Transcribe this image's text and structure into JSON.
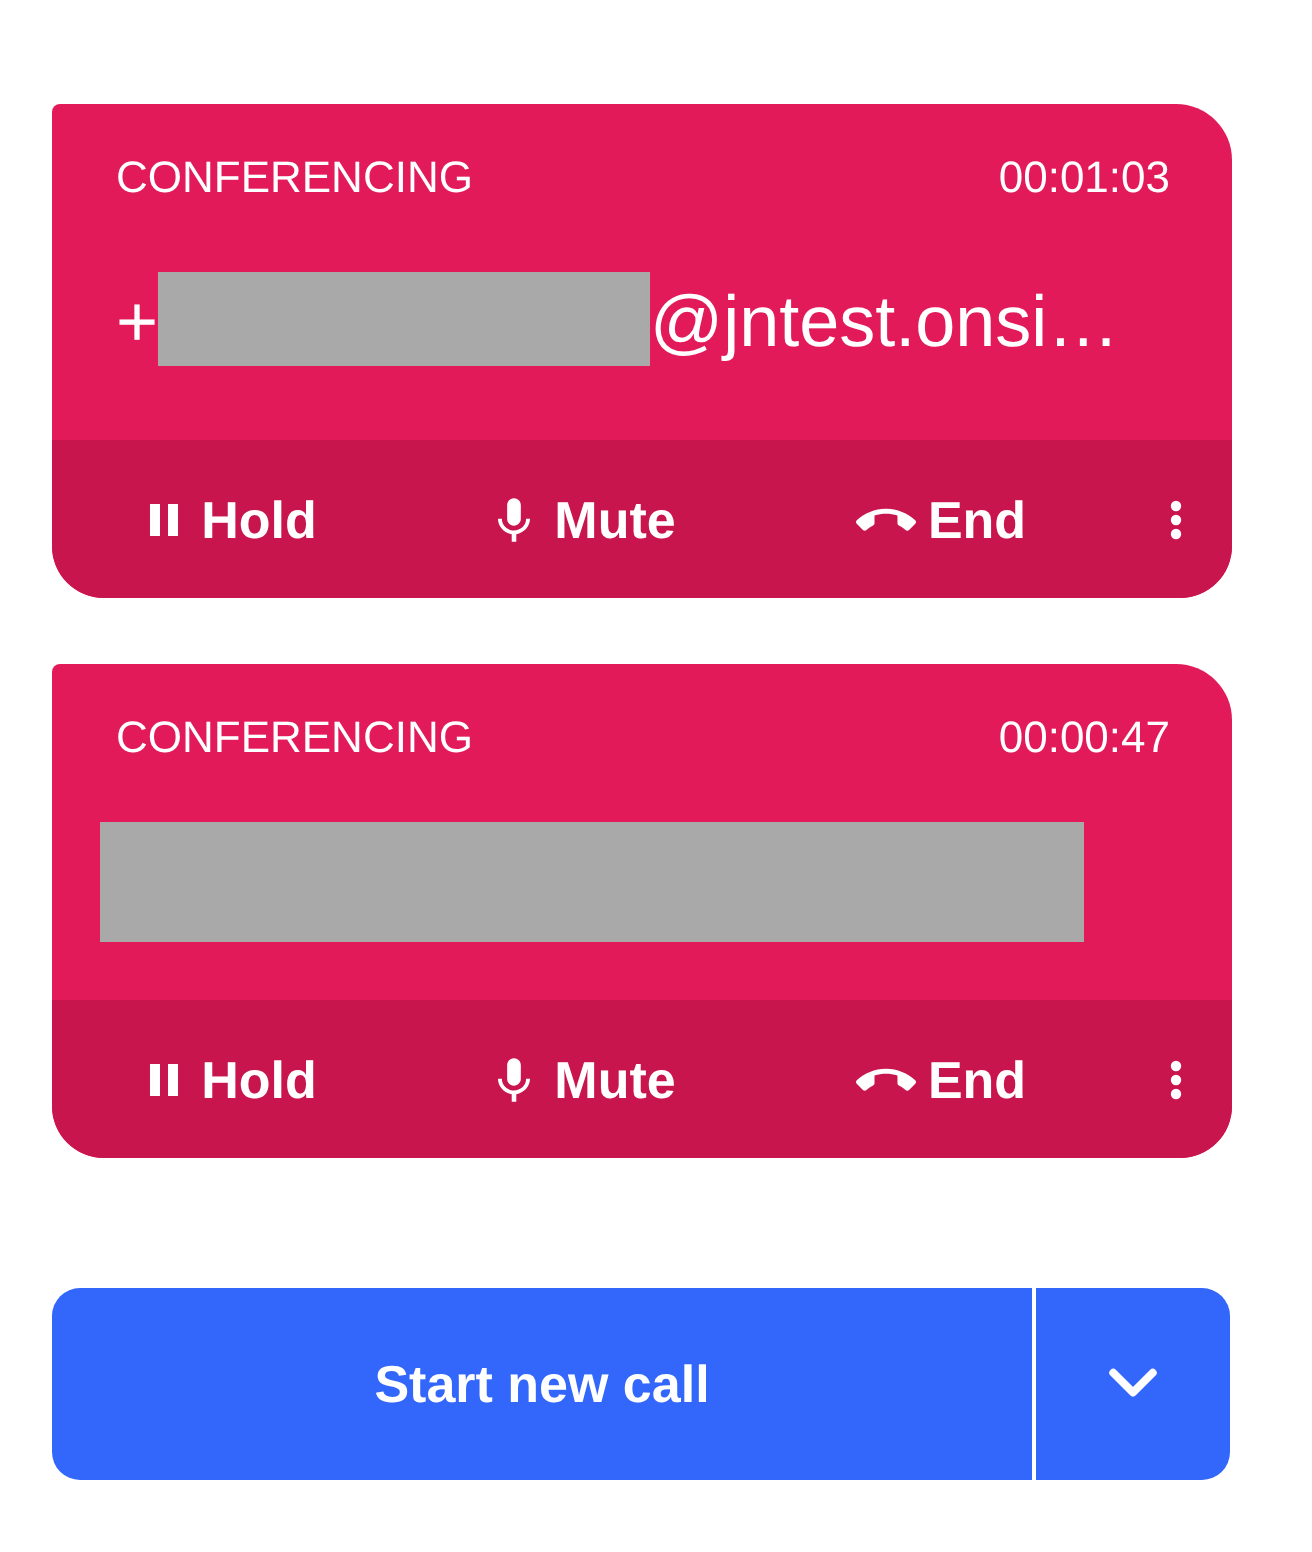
{
  "calls": [
    {
      "status": "CONFERENCING",
      "duration": "00:01:03",
      "address": [
        {
          "kind": "text",
          "text": "+"
        },
        {
          "kind": "redacted"
        },
        {
          "kind": "text",
          "text": "@jntest.onsi…"
        }
      ],
      "actions": [
        {
          "kind": "hold",
          "label": "Hold"
        },
        {
          "kind": "mute",
          "label": "Mute"
        },
        {
          "kind": "end",
          "label": "End"
        }
      ]
    },
    {
      "status": "CONFERENCING",
      "duration": "00:00:47",
      "address": [
        {
          "kind": "redacted"
        }
      ],
      "actions": [
        {
          "kind": "hold",
          "label": "Hold"
        },
        {
          "kind": "mute",
          "label": "Mute"
        },
        {
          "kind": "end",
          "label": "End"
        }
      ]
    }
  ],
  "start_call": {
    "label": "Start new call"
  }
}
